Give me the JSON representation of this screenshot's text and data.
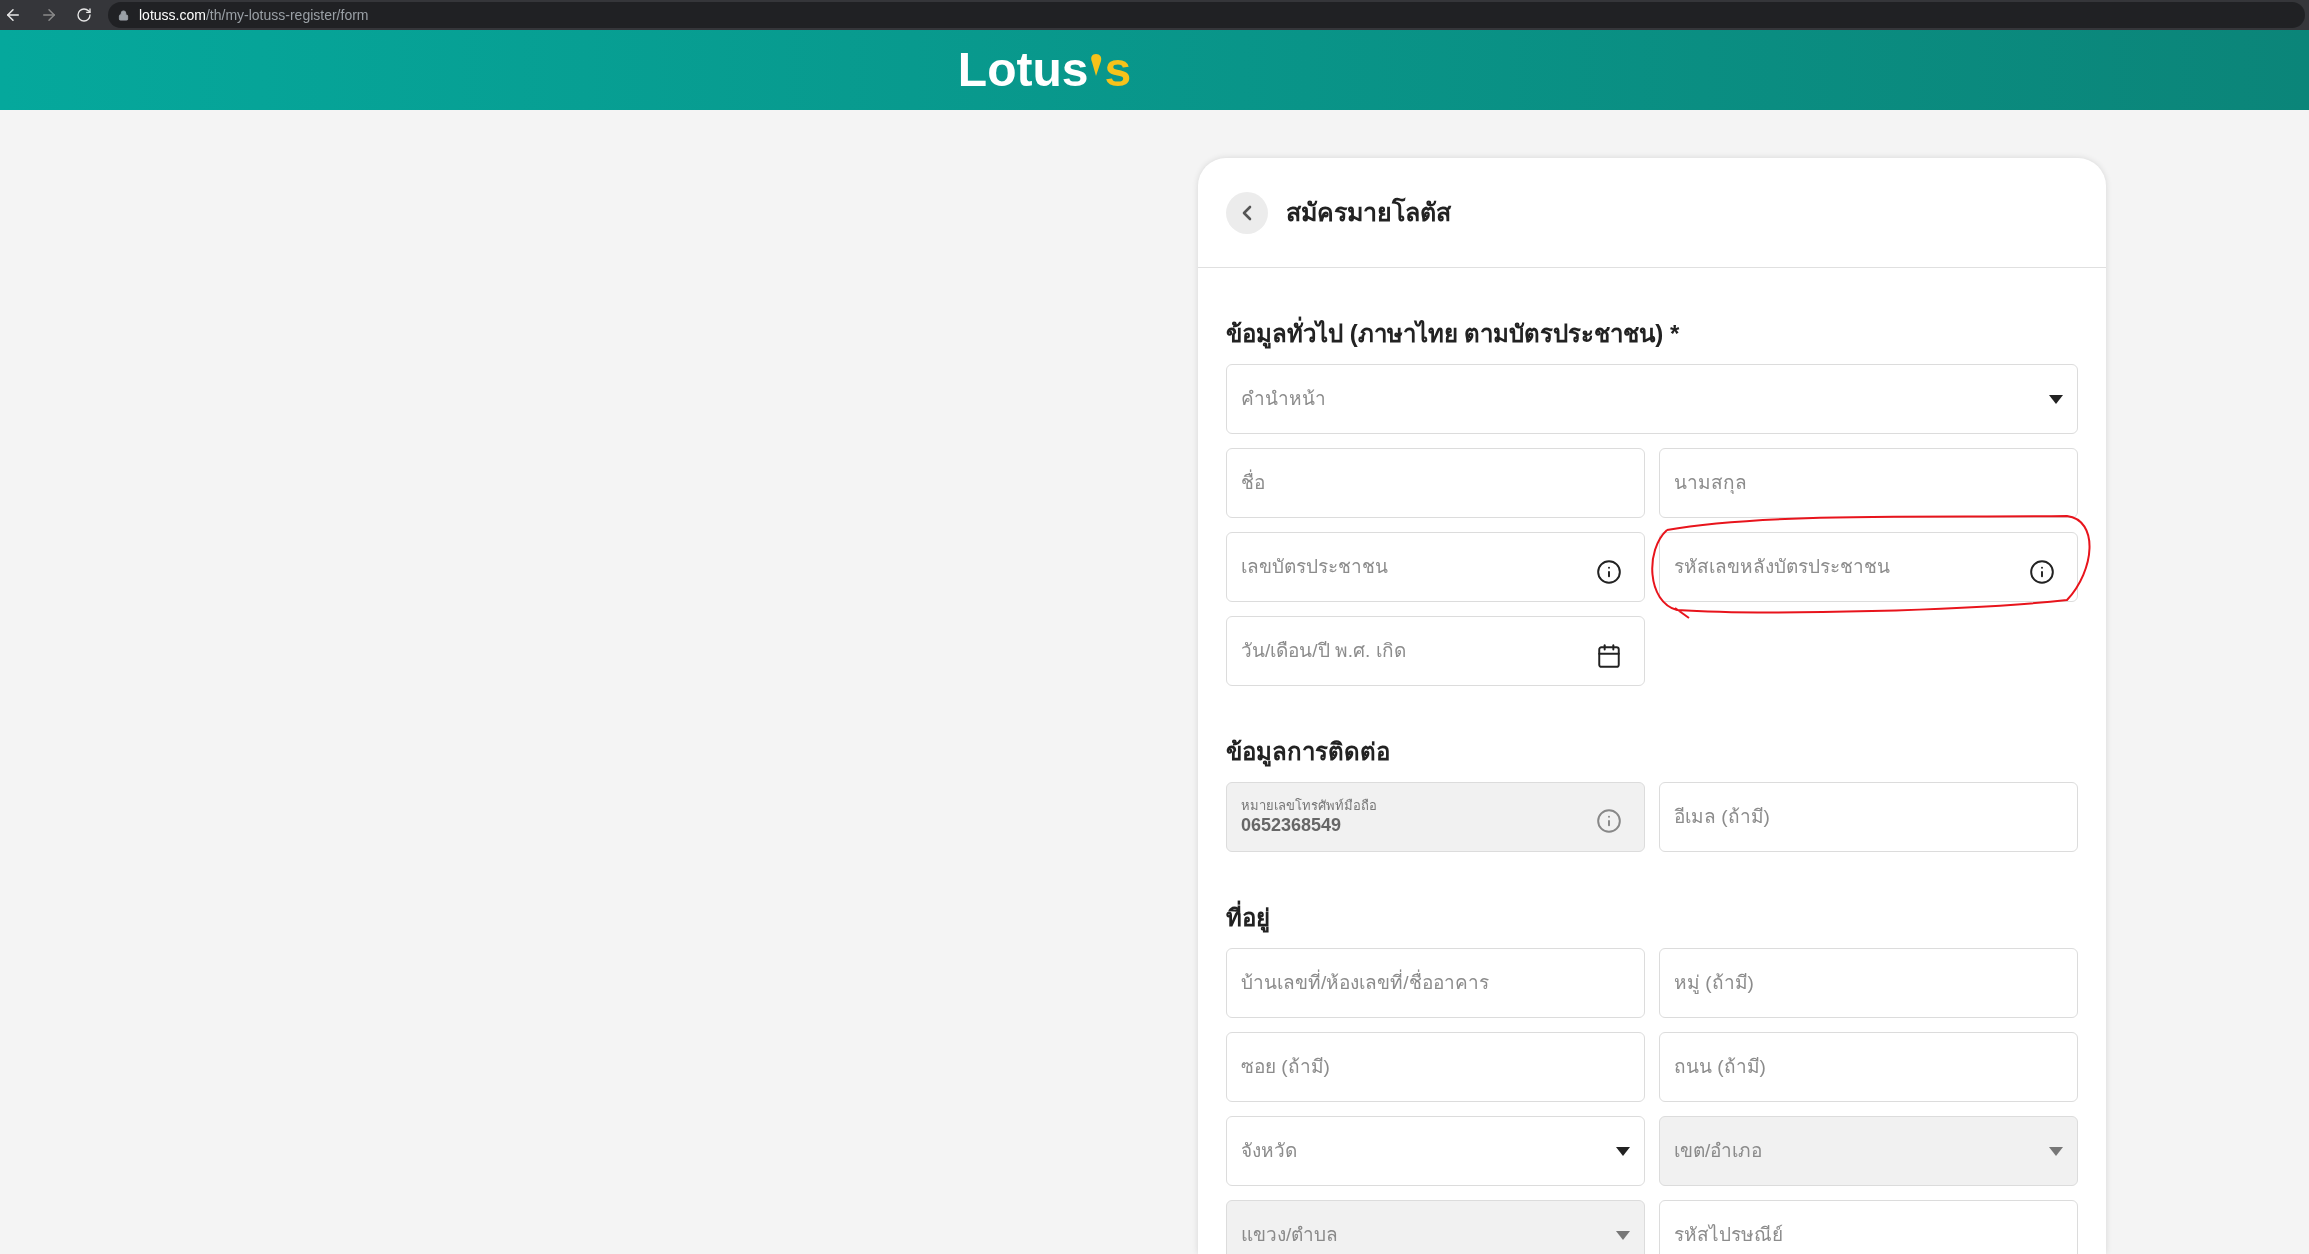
{
  "browser": {
    "url_host": "lotuss.com",
    "url_path": "/th/my-lotuss-register/form"
  },
  "header": {
    "logo_main": "Lotus",
    "logo_accent": "s"
  },
  "card": {
    "title": "สมัครมายโลตัส"
  },
  "sections": [
    {
      "heading": "ข้อมูลทั่วไป (ภาษาไทย ตามบัตรประชาชน) *",
      "fields": [
        {
          "kind": "select",
          "placeholder": "คำนำหน้า",
          "wide": true,
          "disabled": false
        },
        {
          "kind": "text",
          "placeholder": "ชื่อ",
          "wide": false,
          "disabled": false
        },
        {
          "kind": "text",
          "placeholder": "นามสกุล",
          "wide": false,
          "disabled": false
        },
        {
          "kind": "info",
          "placeholder": "เลขบัตรประชาชน",
          "wide": false,
          "disabled": false
        },
        {
          "kind": "info",
          "placeholder": "รหัสเลขหลังบัตรประชาชน",
          "wide": false,
          "disabled": false,
          "circled": true
        },
        {
          "kind": "date",
          "placeholder": "วัน/เดือน/ปี พ.ศ. เกิด",
          "wide": false,
          "disabled": false
        }
      ]
    },
    {
      "heading": "ข้อมูลการติดต่อ",
      "fields": [
        {
          "kind": "filled",
          "label": "หมายเลขโทรศัพท์มือถือ",
          "value": "0652368549",
          "wide": false,
          "disabled": true
        },
        {
          "kind": "text",
          "placeholder": "อีเมล (ถ้ามี)",
          "wide": false,
          "disabled": false
        }
      ]
    },
    {
      "heading": "ที่อยู่",
      "fields": [
        {
          "kind": "text",
          "placeholder": "บ้านเลขที่/ห้องเลขที่/ชื่ออาคาร",
          "wide": false,
          "disabled": false
        },
        {
          "kind": "text",
          "placeholder": "หมู่ (ถ้ามี)",
          "wide": false,
          "disabled": false
        },
        {
          "kind": "text",
          "placeholder": "ซอย (ถ้ามี)",
          "wide": false,
          "disabled": false
        },
        {
          "kind": "text",
          "placeholder": "ถนน (ถ้ามี)",
          "wide": false,
          "disabled": false
        },
        {
          "kind": "select",
          "placeholder": "จังหวัด",
          "wide": false,
          "disabled": false
        },
        {
          "kind": "select",
          "placeholder": "เขต/อำเภอ",
          "wide": false,
          "disabled": true
        },
        {
          "kind": "select",
          "placeholder": "แขวง/ตำบล",
          "wide": false,
          "disabled": true
        },
        {
          "kind": "text",
          "placeholder": "รหัสไปรษณีย์",
          "wide": false,
          "disabled": false
        }
      ]
    }
  ]
}
